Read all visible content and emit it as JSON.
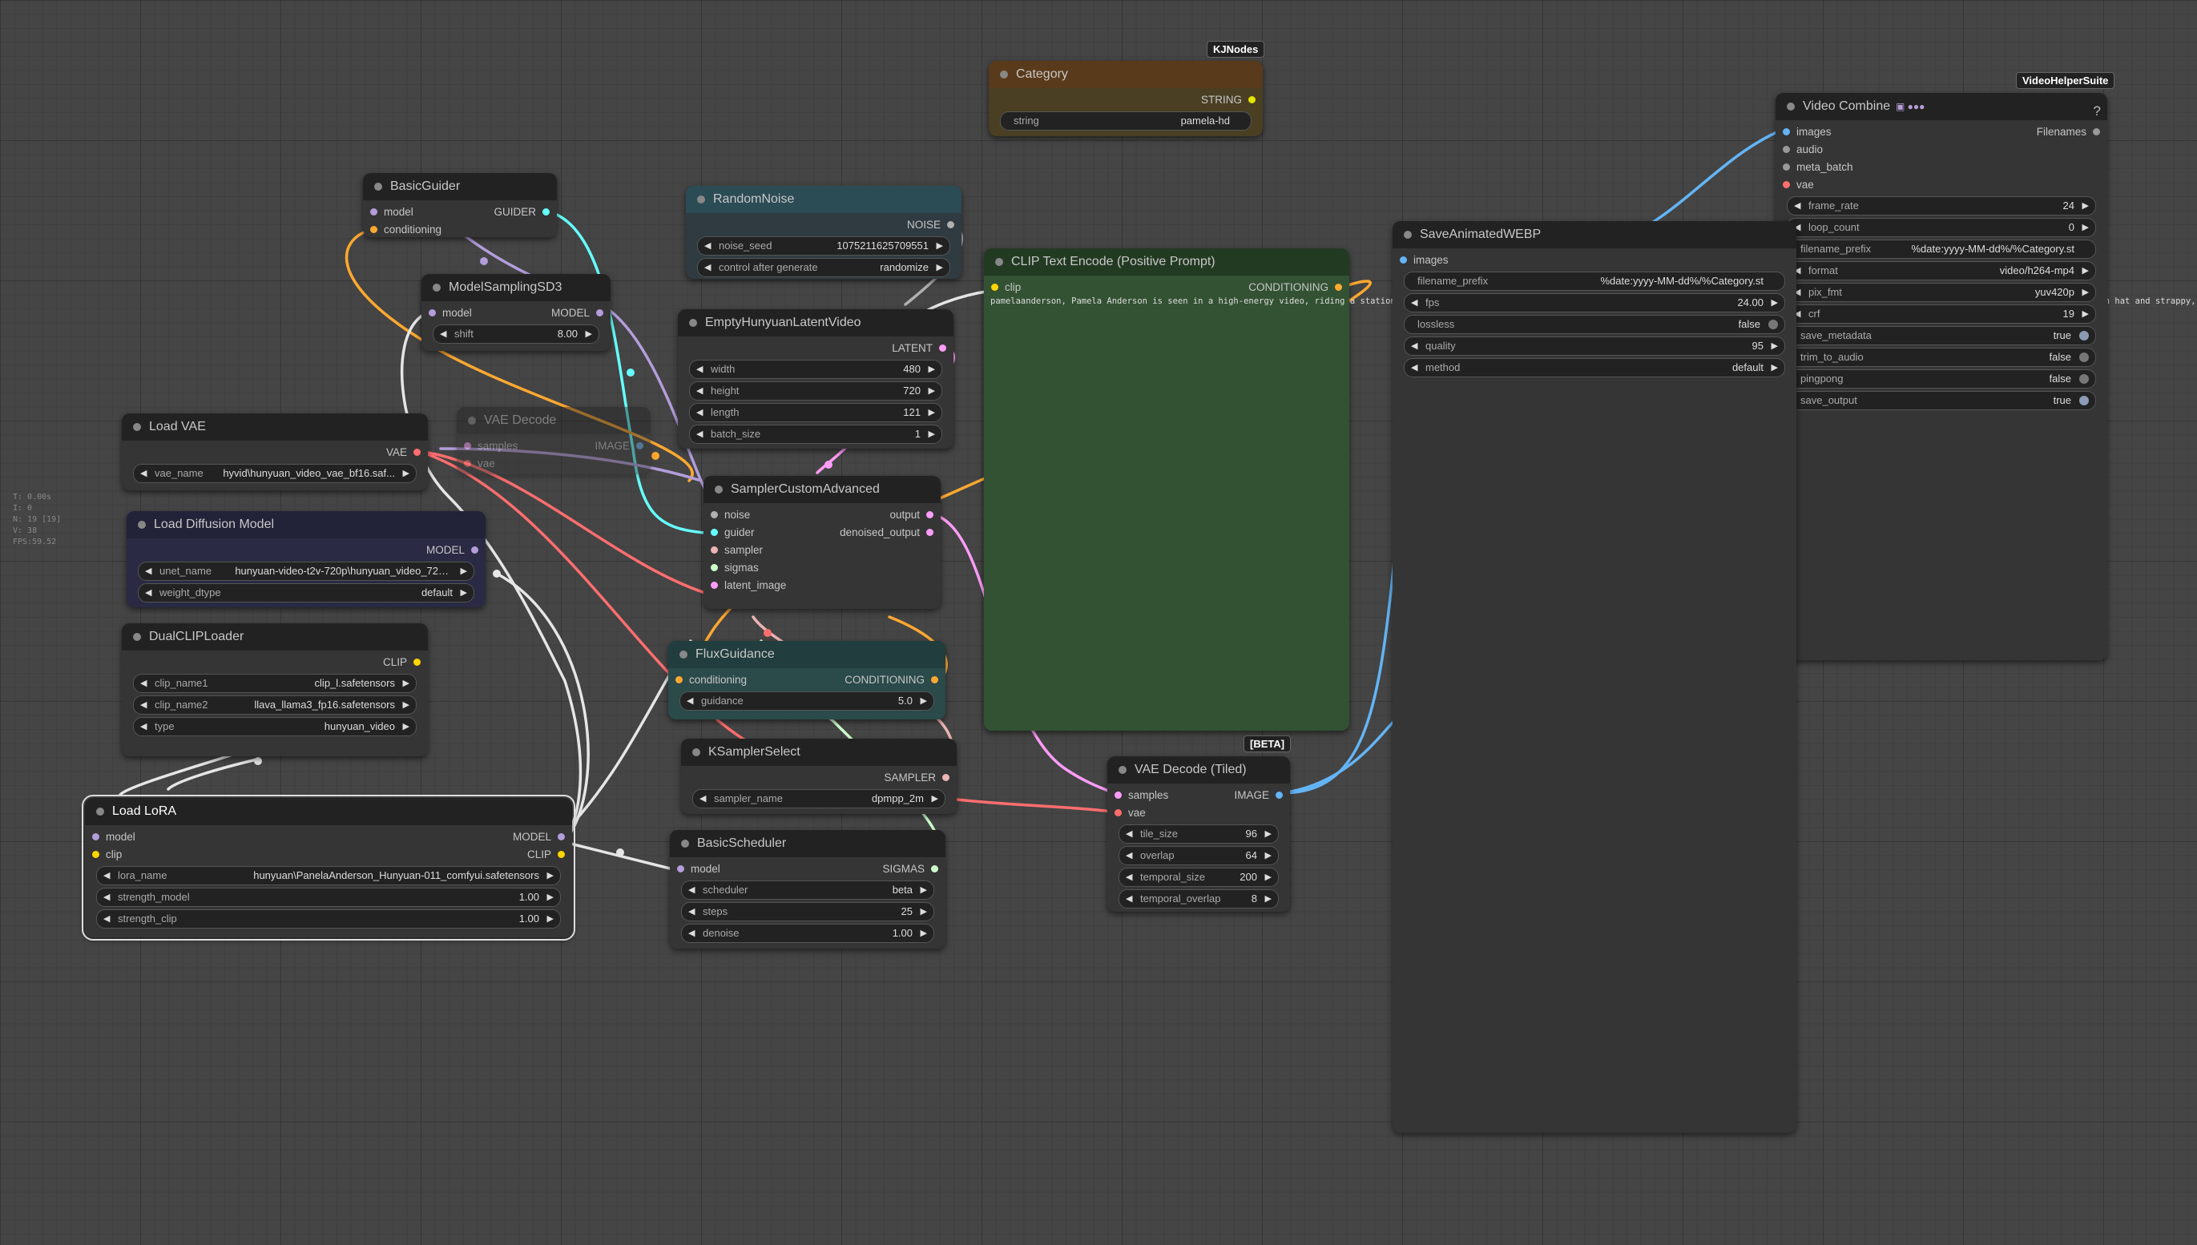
{
  "colors": {
    "canvas_bg": "#454545",
    "node_bg": "#353535",
    "title_bg": "#222222",
    "clip_yellow": "#ffd500",
    "model_lavender": "#b39ddb",
    "vae_red": "#ff6e6e",
    "conditioning_orange": "#ffa931",
    "latent_pink": "#ff9cf9",
    "image_blue": "#64b5f6",
    "guider_cyan": "#66ffff",
    "sampler_salmon": "#ecb4b4",
    "sigmas_green": "#cdffcd",
    "noise_grey": "#b0b0b0",
    "string_gold": "#e5e500"
  },
  "info_overlay": [
    "T: 0.00s",
    "I: 0",
    "N: 19 [19]",
    "V: 38",
    "FPS:59.52"
  ],
  "badges": {
    "kjnodes": "KJNodes",
    "vhs": "VideoHelperSuite",
    "beta": "[BETA]"
  },
  "nodes": {
    "category": {
      "title": "Category",
      "out": "STRING",
      "widgets": [
        {
          "label": "string",
          "value": "pamela-hd"
        }
      ]
    },
    "basic_guider": {
      "title": "BasicGuider",
      "inputs": [
        "model",
        "conditioning"
      ],
      "out": "GUIDER"
    },
    "random_noise": {
      "title": "RandomNoise",
      "out": "NOISE",
      "widgets": [
        {
          "label": "noise_seed",
          "value": "1075211625709551"
        },
        {
          "label": "control after generate",
          "value": "randomize"
        }
      ]
    },
    "model_sampling": {
      "title": "ModelSamplingSD3",
      "inputs": [
        "model"
      ],
      "out": "MODEL",
      "widgets": [
        {
          "label": "shift",
          "value": "8.00"
        }
      ]
    },
    "empty_latent": {
      "title": "EmptyHunyuanLatentVideo",
      "out": "LATENT",
      "widgets": [
        {
          "label": "width",
          "value": "480"
        },
        {
          "label": "height",
          "value": "720"
        },
        {
          "label": "length",
          "value": "121"
        },
        {
          "label": "batch_size",
          "value": "1"
        }
      ]
    },
    "clip_text": {
      "title": "CLIP Text Encode (Positive Prompt)",
      "inputs": [
        "clip"
      ],
      "out": "CONDITIONING",
      "text": "pamelaanderson, Pamela Anderson is seen in a high-energy video, riding a stationary exercise bike while wearing a light blue, modest yoga top and matching white yoga pants. She accessorizes with a large, white, floppy sun hat and strappy, black-colore"
    },
    "save_webp": {
      "title": "SaveAnimatedWEBP",
      "inputs": [
        "images"
      ],
      "widgets": [
        {
          "label": "filename_prefix",
          "value": "%date:yyyy-MM-dd%/%Category.st"
        },
        {
          "label": "fps",
          "value": "24.00"
        },
        {
          "label": "lossless",
          "value": "false"
        },
        {
          "label": "quality",
          "value": "95"
        },
        {
          "label": "method",
          "value": "default"
        }
      ]
    },
    "video_combine": {
      "title": "Video Combine",
      "title_icons": "▣ ●●●",
      "help": "?",
      "inputs": [
        "images",
        "audio",
        "meta_batch",
        "vae"
      ],
      "out": "Filenames",
      "widgets": [
        {
          "label": "frame_rate",
          "value": "24"
        },
        {
          "label": "loop_count",
          "value": "0"
        },
        {
          "label": "filename_prefix",
          "value": "%date:yyyy-MM-dd%/%Category.st"
        },
        {
          "label": "format",
          "value": "video/h264-mp4"
        },
        {
          "label": "pix_fmt",
          "value": "yuv420p"
        },
        {
          "label": "crf",
          "value": "19"
        }
      ],
      "toggles": [
        {
          "label": "save_metadata",
          "value": "true"
        },
        {
          "label": "trim_to_audio",
          "value": "false"
        },
        {
          "label": "pingpong",
          "value": "false"
        },
        {
          "label": "save_output",
          "value": "true"
        }
      ]
    },
    "load_vae": {
      "title": "Load VAE",
      "out": "VAE",
      "widgets": [
        {
          "label": "vae_name",
          "value": "hyvid\\hunyuan_video_vae_bf16.saf..."
        }
      ]
    },
    "vae_decode": {
      "title": "VAE Decode",
      "inputs": [
        "samples",
        "vae"
      ],
      "out": "IMAGE"
    },
    "sampler_custom": {
      "title": "SamplerCustomAdvanced",
      "inputs": [
        "noise",
        "guider",
        "sampler",
        "sigmas",
        "latent_image"
      ],
      "outs": [
        "output",
        "denoised_output"
      ]
    },
    "load_diffusion": {
      "title": "Load Diffusion Model",
      "out": "MODEL",
      "widgets": [
        {
          "label": "unet_name",
          "value": "hunyuan-video-t2v-720p\\hunyuan_video_720_..."
        },
        {
          "label": "weight_dtype",
          "value": "default"
        }
      ]
    },
    "dual_clip": {
      "title": "DualCLIPLoader",
      "out": "CLIP",
      "widgets": [
        {
          "label": "clip_name1",
          "value": "clip_l.safetensors"
        },
        {
          "label": "clip_name2",
          "value": "llava_llama3_fp16.safetensors"
        },
        {
          "label": "type",
          "value": "hunyuan_video"
        }
      ]
    },
    "flux_guidance": {
      "title": "FluxGuidance",
      "inputs": [
        "conditioning"
      ],
      "out": "CONDITIONING",
      "widgets": [
        {
          "label": "guidance",
          "value": "5.0"
        }
      ]
    },
    "ksampler_select": {
      "title": "KSamplerSelect",
      "out": "SAMPLER",
      "widgets": [
        {
          "label": "sampler_name",
          "value": "dpmpp_2m"
        }
      ]
    },
    "vae_decode_tiled": {
      "title": "VAE Decode (Tiled)",
      "inputs": [
        "samples",
        "vae"
      ],
      "out": "IMAGE",
      "widgets": [
        {
          "label": "tile_size",
          "value": "96"
        },
        {
          "label": "overlap",
          "value": "64"
        },
        {
          "label": "temporal_size",
          "value": "200"
        },
        {
          "label": "temporal_overlap",
          "value": "8"
        }
      ]
    },
    "load_lora": {
      "title": "Load LoRA",
      "inputs": [
        "model",
        "clip"
      ],
      "outs": [
        "MODEL",
        "CLIP"
      ],
      "widgets": [
        {
          "label": "lora_name",
          "value": "hunyuan\\PanelaAnderson_Hunyuan-011_comfyui.safetensors"
        },
        {
          "label": "strength_model",
          "value": "1.00"
        },
        {
          "label": "strength_clip",
          "value": "1.00"
        }
      ]
    },
    "basic_scheduler": {
      "title": "BasicScheduler",
      "inputs": [
        "model"
      ],
      "out": "SIGMAS",
      "widgets": [
        {
          "label": "scheduler",
          "value": "beta"
        },
        {
          "label": "steps",
          "value": "25"
        },
        {
          "label": "denoise",
          "value": "1.00"
        }
      ]
    }
  }
}
